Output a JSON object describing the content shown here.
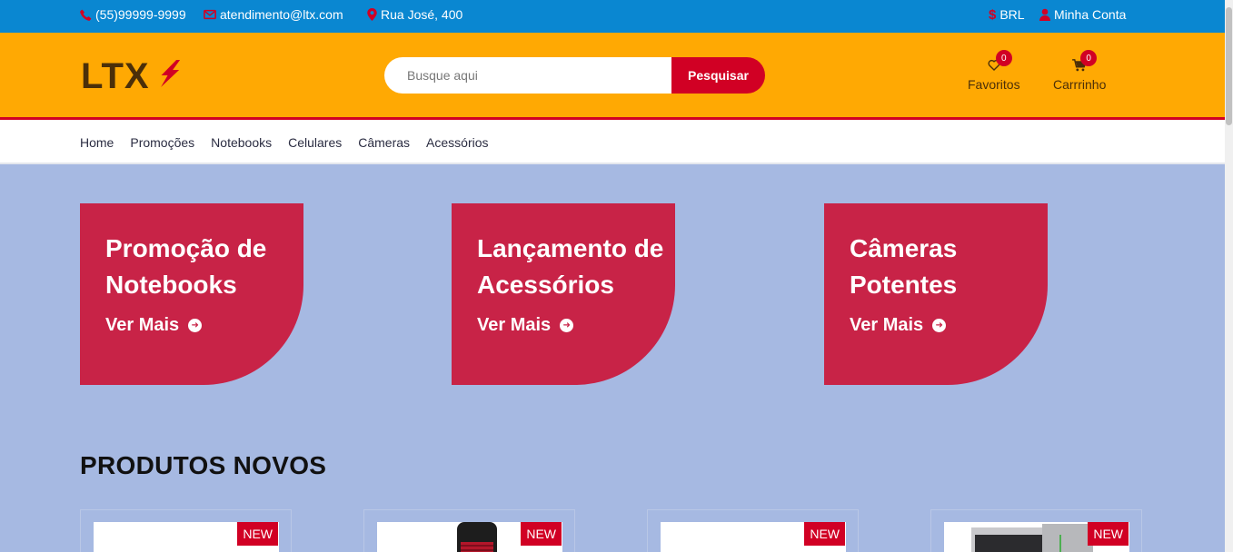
{
  "topbar": {
    "phone": "(55)99999-9999",
    "email": "atendimento@ltx.com",
    "address": "Rua José, 400",
    "currency": "BRL",
    "account": "Minha Conta"
  },
  "header": {
    "logo": "LTX",
    "search_placeholder": "Busque aqui",
    "search_button": "Pesquisar",
    "favorites_label": "Favoritos",
    "favorites_count": "0",
    "cart_label": "Carrrinho",
    "cart_count": "0"
  },
  "nav": {
    "items": [
      "Home",
      "Promoções",
      "Notebooks",
      "Celulares",
      "Câmeras",
      "Acessórios"
    ]
  },
  "banners": [
    {
      "title": "Promoção de Notebooks",
      "cta": "Ver Mais"
    },
    {
      "title": "Lançamento de Acessórios",
      "cta": "Ver Mais"
    },
    {
      "title": "Câmeras Potentes",
      "cta": "Ver Mais"
    }
  ],
  "products_section": {
    "title": "PRODUTOS NOVOS",
    "cards": [
      {
        "tag": "NEW",
        "image": "blank"
      },
      {
        "tag": "NEW",
        "image": "red-black-cylinder-product"
      },
      {
        "tag": "NEW",
        "image": "blank"
      },
      {
        "tag": "NEW",
        "image": "gray-tower-product"
      }
    ]
  },
  "colors": {
    "topbar": "#0a87d1",
    "header": "#ffa903",
    "accent": "#d10024",
    "banner": "#c82347",
    "page_bg": "#a6b9e2"
  }
}
